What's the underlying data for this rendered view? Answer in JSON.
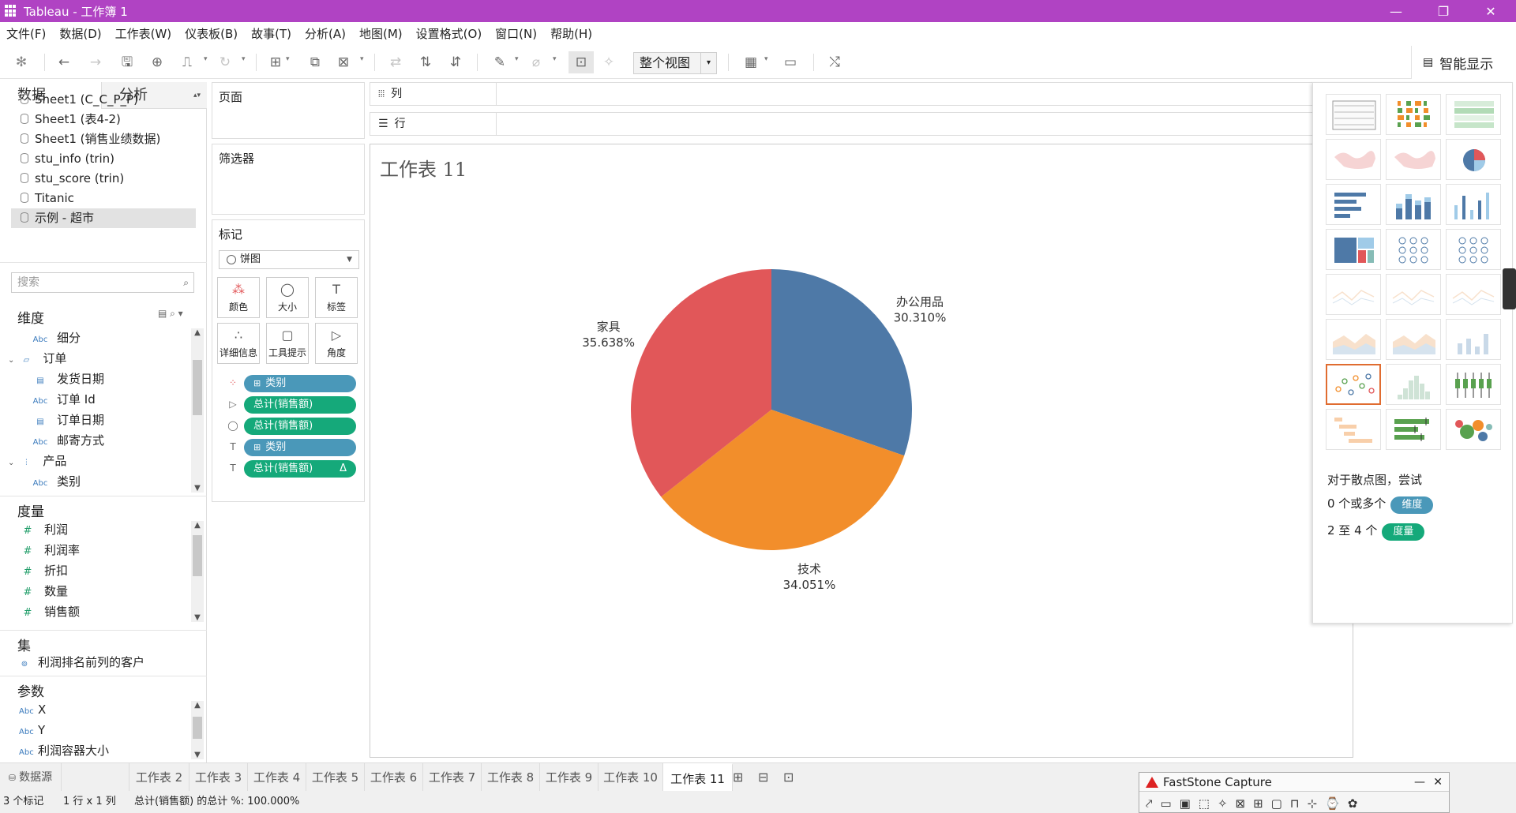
{
  "window": {
    "title": "Tableau - 工作簿 1"
  },
  "menu": [
    "文件(F)",
    "数据(D)",
    "工作表(W)",
    "仪表板(B)",
    "故事(T)",
    "分析(A)",
    "地图(M)",
    "设置格式(O)",
    "窗口(N)",
    "帮助(H)"
  ],
  "toolbar": {
    "fit_label": "整个视图",
    "smart_show_label": "智能显示"
  },
  "left_tabs": {
    "data": "数据",
    "analysis": "分析"
  },
  "datasources": [
    "Sheet1 (C_C_P_P)",
    "Sheet1 (表4-2)",
    "Sheet1 (销售业绩数据)",
    "stu_info (trin)",
    "stu_score (trin)",
    "Titanic",
    "示例 - 超市"
  ],
  "search_placeholder": "搜索",
  "dimensions": {
    "title": "维度",
    "items": [
      {
        "icon": "Abc",
        "label": "细分"
      },
      {
        "icon": "folder",
        "label": "订单",
        "folder": true
      },
      {
        "icon": "date",
        "label": "发货日期"
      },
      {
        "icon": "Abc",
        "label": "订单 Id"
      },
      {
        "icon": "date",
        "label": "订单日期"
      },
      {
        "icon": "Abc",
        "label": "邮寄方式"
      },
      {
        "icon": "hier",
        "label": "产品",
        "folder": true
      },
      {
        "icon": "Abc",
        "label": "类别"
      }
    ]
  },
  "measures": {
    "title": "度量",
    "items": [
      "利润",
      "利润率",
      "折扣",
      "数量",
      "销售额"
    ]
  },
  "sets": {
    "title": "集",
    "items": [
      "利润排名前列的客户"
    ]
  },
  "params": {
    "title": "参数",
    "items": [
      "X",
      "Y",
      "利润容器大小"
    ]
  },
  "shelves": {
    "pages": "页面",
    "filters": "筛选器",
    "marks": "标记",
    "columns": "列",
    "rows": "行"
  },
  "marks": {
    "type": "饼图",
    "buttons": [
      "颜色",
      "大小",
      "标签",
      "详细信息",
      "工具提示",
      "角度"
    ],
    "pills": [
      {
        "icon": "color",
        "label": "类别",
        "kind": "dim",
        "prefix": "⊞"
      },
      {
        "icon": "angle",
        "label": "总计(销售额)",
        "kind": "mea",
        "prefix": ""
      },
      {
        "icon": "size",
        "label": "总计(销售额)",
        "kind": "mea",
        "prefix": ""
      },
      {
        "icon": "label",
        "label": "类别",
        "kind": "dim",
        "prefix": "⊞"
      },
      {
        "icon": "label",
        "label": "总计(销售额)",
        "kind": "mea",
        "prefix": "",
        "suffix": "Δ"
      }
    ]
  },
  "sheet_title": "工作表 11",
  "chart_data": {
    "type": "pie",
    "title": "工作表 11",
    "slices": [
      {
        "label": "办公用品",
        "pct": 30.31,
        "pct_text": "30.310%",
        "color": "#4e79a7"
      },
      {
        "label": "技术",
        "pct": 34.051,
        "pct_text": "34.051%",
        "color": "#f28e2b"
      },
      {
        "label": "家具",
        "pct": 35.638,
        "pct_text": "35.638%",
        "color": "#e15759"
      }
    ]
  },
  "showme": {
    "hint": "对于散点图，尝试",
    "req1_prefix": "0 个或多个",
    "req1_tag": "维度",
    "req1_color": "#4a98b9",
    "req2_prefix": "2 至 4 个",
    "req2_tag": "度量",
    "req2_color": "#15a97a"
  },
  "sheet_tabs": {
    "datasource": "数据源",
    "tabs": [
      "工作表 2",
      "工作表 3",
      "工作表 4",
      "工作表 5",
      "工作表 6",
      "工作表 7",
      "工作表 8",
      "工作表 9",
      "工作表 10",
      "工作表 11"
    ],
    "active": 9
  },
  "status": {
    "marks": "3 个标记",
    "rowscols": "1 行 x 1 列",
    "sum": "总计(销售额) 的总计 %: 100.000%"
  },
  "faststone": {
    "title": "FastStone Capture"
  }
}
